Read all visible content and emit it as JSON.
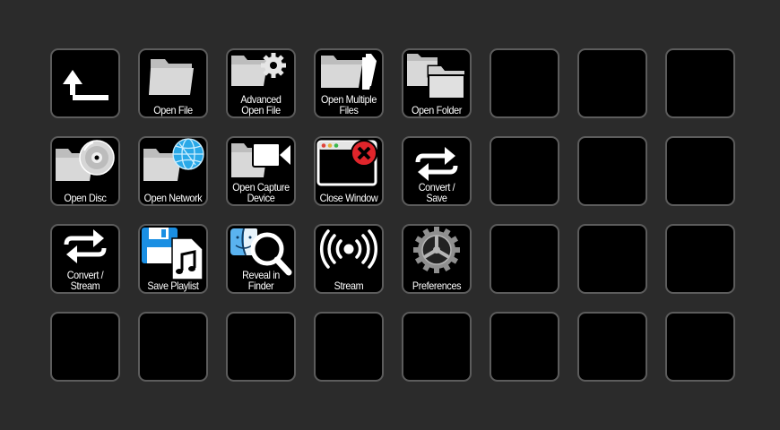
{
  "keys": [
    {
      "label": "",
      "icon": "back-arrow-icon"
    },
    {
      "label": "Open File",
      "icon": "folder-icon"
    },
    {
      "label": "Advanced\nOpen File",
      "icon": "folder-gear-icon"
    },
    {
      "label": "Open Multiple\nFiles",
      "icon": "folder-multiple-icon"
    },
    {
      "label": "Open Folder",
      "icon": "folder-stack-icon"
    },
    {
      "label": "Open Disc",
      "icon": "folder-disc-icon"
    },
    {
      "label": "Open Network",
      "icon": "folder-globe-icon"
    },
    {
      "label": "Open Capture\nDevice",
      "icon": "folder-camera-icon"
    },
    {
      "label": "Close Window",
      "icon": "window-close-icon"
    },
    {
      "label": "Convert /\nSave",
      "icon": "convert-arrows-icon"
    },
    {
      "label": "Convert /\nStream",
      "icon": "convert-arrows-icon"
    },
    {
      "label": "Save Playlist",
      "icon": "floppy-music-icon"
    },
    {
      "label": "Reveal in\nFinder",
      "icon": "finder-magnifier-icon"
    },
    {
      "label": "Stream",
      "icon": "broadcast-icon"
    },
    {
      "label": "Preferences",
      "icon": "gear-icon"
    }
  ],
  "colors": {
    "background": "#2b2b2b",
    "key": "#000000",
    "key_border": "#5c5c5c",
    "folder": "#d4d4d4",
    "close_red": "#e0252b",
    "floppy_blue": "#1a8fe3",
    "globe_blue": "#2aa9e8"
  }
}
